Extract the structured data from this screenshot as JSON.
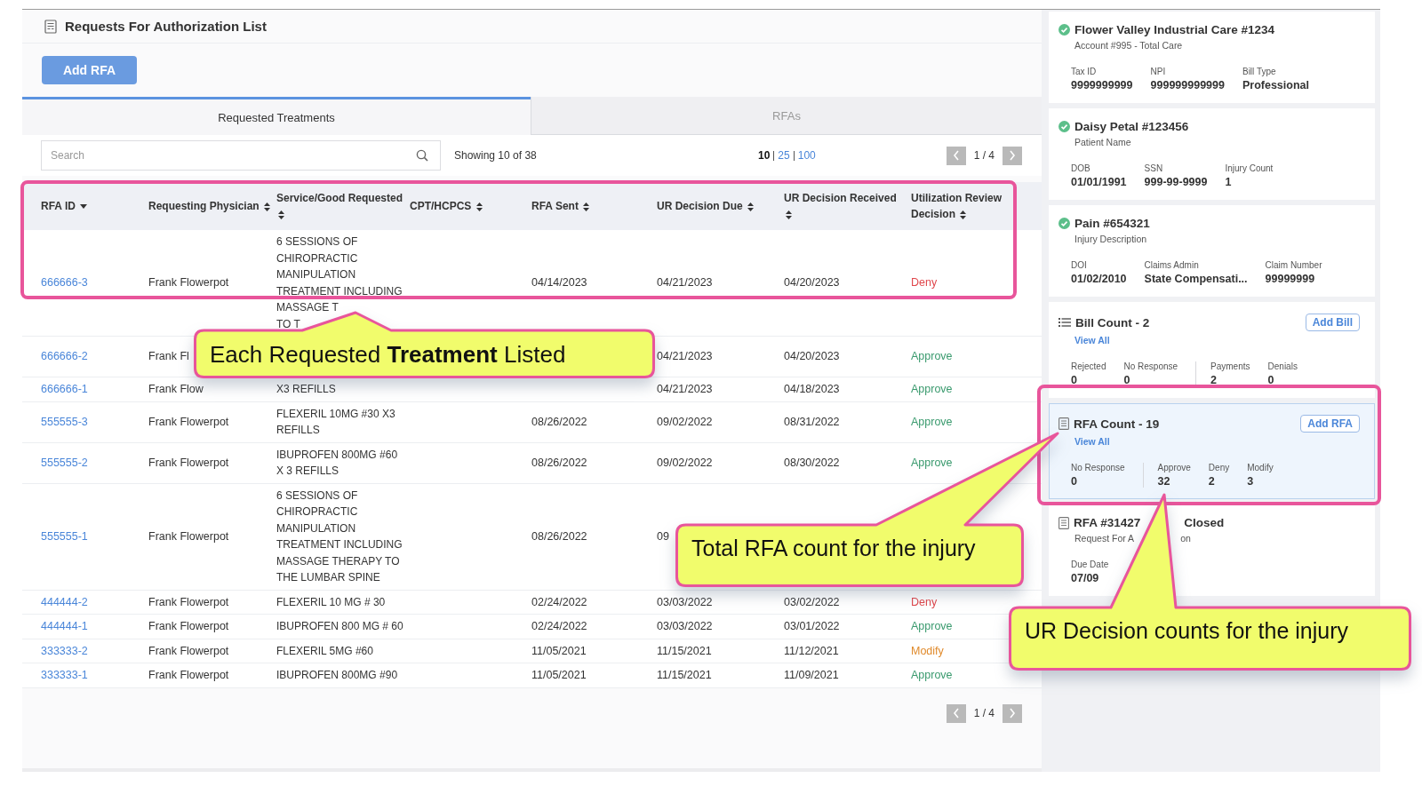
{
  "page": {
    "title": "Requests For Authorization List",
    "add_button": "Add RFA"
  },
  "tabs": [
    {
      "label": "Requested Treatments",
      "selected": true
    },
    {
      "label": "RFAs",
      "selected": false
    }
  ],
  "search": {
    "placeholder": "Search"
  },
  "showing": "Showing 10 of 38",
  "page_sizes": [
    {
      "label": "10",
      "selected": true
    },
    {
      "label": "25",
      "selected": false
    },
    {
      "label": "100",
      "selected": false
    }
  ],
  "pager_top": {
    "text": "1 / 4"
  },
  "table": {
    "columns": [
      {
        "label": "RFA ID",
        "sorted": true
      },
      {
        "label": "Requesting Physician",
        "sorted": false
      },
      {
        "label": "Service/Good Requested",
        "sorted": false
      },
      {
        "label": "CPT/HCPCS",
        "sorted": false
      },
      {
        "label": "RFA Sent",
        "sorted": false
      },
      {
        "label": "UR Decision Due",
        "sorted": false
      },
      {
        "label": "UR Decision Received",
        "sorted": false
      },
      {
        "label": "Utilization Review Decision",
        "sorted": false
      }
    ],
    "rows": [
      {
        "id": "666666-3",
        "physician": "Frank Flowerpot",
        "service": "6 SESSIONS OF CHIROPRACTIC MANIPULATION TREATMENT INCLUDING\nMASSAGE T\nTO T",
        "sent": "04/14/2023",
        "due": "04/21/2023",
        "received": "04/20/2023",
        "decision": "Deny",
        "color": "#e0474c"
      },
      {
        "id": "666666-2",
        "physician": "Frank Fl",
        "due": "04/21/2023",
        "received": "04/20/2023",
        "decision": "Approve",
        "color": "#3a9a6e"
      },
      {
        "id": "666666-1",
        "physician": "Frank Flow",
        "service": "X3 REFILLS",
        "due": "04/21/2023",
        "received": "04/18/2023",
        "decision": "Approve",
        "color": "#3a9a6e"
      },
      {
        "id": "555555-3",
        "physician": "Frank Flowerpot",
        "service": "FLEXERIL 10MG #30 X3 REFILLS",
        "sent": "08/26/2022",
        "due": "09/02/2022",
        "received": "08/31/2022",
        "decision": "Approve",
        "color": "#3a9a6e"
      },
      {
        "id": "555555-2",
        "physician": "Frank Flowerpot",
        "service": "IBUPROFEN 800MG #60 X 3 REFILLS",
        "sent": "08/26/2022",
        "due": "09/02/2022",
        "received": "08/30/2022",
        "decision": "Approve",
        "color": "#3a9a6e"
      },
      {
        "id": "555555-1",
        "physician": "Frank Flowerpot",
        "service": "6 SESSIONS OF CHIROPRACTIC MANIPULATION TREATMENT INCLUDING MASSAGE THERAPY TO THE LUMBAR SPINE",
        "sent": "08/26/2022",
        "due": "09"
      },
      {
        "id": "444444-2",
        "physician": "Frank Flowerpot",
        "service": "FLEXERIL 10 MG # 30",
        "sent": "02/24/2022",
        "due": "03/03/2022",
        "received": "03/02/2022",
        "decision": "Deny",
        "color": "#e0474c"
      },
      {
        "id": "444444-1",
        "physician": "Frank Flowerpot",
        "service": "IBUPROFEN 800 MG # 60",
        "sent": "02/24/2022",
        "due": "03/03/2022",
        "received": "03/01/2022",
        "decision": "Approve",
        "color": "#3a9a6e"
      },
      {
        "id": "333333-2",
        "physician": "Frank Flowerpot",
        "service": "FLEXERIL 5MG #60",
        "sent": "11/05/2021",
        "due": "11/15/2021",
        "received": "11/12/2021",
        "decision": "Modify",
        "color": "#e08a2b"
      },
      {
        "id": "333333-1",
        "physician": "Frank Flowerpot",
        "service": "IBUPROFEN 800MG #90",
        "sent": "11/05/2021",
        "due": "11/15/2021",
        "received": "11/09/2021",
        "decision": "Approve",
        "color": "#3a9a6e"
      }
    ]
  },
  "pager_bottom": {
    "text": "1 / 4"
  },
  "cards": [
    {
      "kind": "verified",
      "title": "Flower Valley Industrial Care #1234",
      "subtitle": "Account #995 - Total Care",
      "selected": false,
      "fields": [
        {
          "label": "Tax ID",
          "value": "9999999999"
        },
        {
          "label": "NPI",
          "value": "999999999999"
        },
        {
          "label": "Bill Type",
          "value": "Professional"
        }
      ]
    },
    {
      "kind": "verified",
      "title": "Daisy Petal #123456",
      "subtitle": "Patient Name",
      "selected": false,
      "fields": [
        {
          "label": "DOB",
          "value": "01/01/1991"
        },
        {
          "label": "SSN",
          "value": "999-99-9999"
        },
        {
          "label": "Injury Count",
          "value": "1"
        }
      ]
    },
    {
      "kind": "verified",
      "title": "Pain #654321",
      "subtitle": "Injury Description",
      "selected": false,
      "fields": [
        {
          "label": "DOI",
          "value": "01/02/2010"
        },
        {
          "label": "Claims Admin",
          "value": "State Compensati..."
        },
        {
          "label": "Claim Number",
          "value": "99999999"
        }
      ]
    },
    {
      "kind": "bill-count",
      "title": "Bill Count - 2",
      "button": "Add Bill",
      "link": "View All",
      "selected": false,
      "groups": [
        [
          {
            "label": "Rejected",
            "value": "0"
          },
          {
            "label": "No Response",
            "value": "0"
          }
        ],
        [
          {
            "label": "Payments",
            "value": "2"
          },
          {
            "label": "Denials",
            "value": "0"
          }
        ]
      ]
    },
    {
      "kind": "rfa-count",
      "title": "RFA Count - 19",
      "button": "Add RFA",
      "link": "View All",
      "selected": true,
      "groups": [
        [
          {
            "label": "No Response",
            "value": "0"
          }
        ],
        [
          {
            "label": "Approve",
            "value": "32"
          },
          {
            "label": "Deny",
            "value": "2"
          },
          {
            "label": "Modify",
            "value": "3"
          }
        ]
      ]
    },
    {
      "kind": "rfa",
      "title": "RFA #31427",
      "title_tail": "Closed",
      "subtitle": "Request For A",
      "subtitle_tail": "on",
      "selected": false,
      "fields": [
        {
          "label": "Due Date",
          "value": "07/09"
        }
      ]
    }
  ],
  "callouts": [
    {
      "text": "Each Requested **Treatment** Listed"
    },
    {
      "text": "Total RFA count for the injury"
    },
    {
      "text": "UR Decision counts for the injury"
    }
  ]
}
